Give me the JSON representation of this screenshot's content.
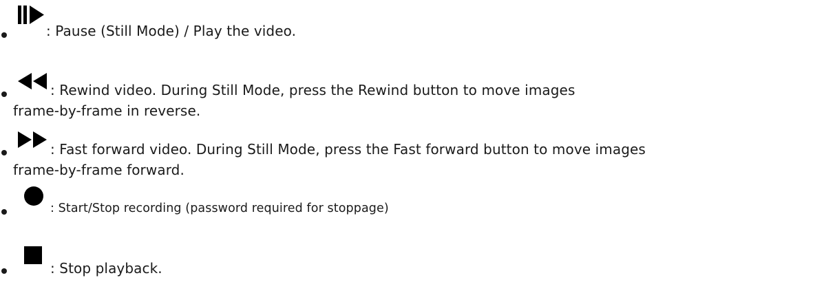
{
  "items": [
    {
      "icon": "pause-play-icon",
      "line1": ": Pause (Still Mode) / Play the video.",
      "line2": ""
    },
    {
      "icon": "rewind-icon",
      "line1": ": Rewind video. During Still Mode, press the Rewind button to move images",
      "line2": "frame-by-frame in reverse."
    },
    {
      "icon": "fast-forward-icon",
      "line1": ": Fast forward video. During Still Mode, press the Fast forward button to move images",
      "line2": "frame-by-frame forward."
    },
    {
      "icon": "record-icon",
      "line1": ": Start/Stop recording (password required for stoppage)",
      "line2": ""
    },
    {
      "icon": "stop-icon",
      "line1": ": Stop playback.",
      "line2": ""
    }
  ],
  "colors": {
    "text": "#1a1a1a",
    "icon": "#000000",
    "background": "#ffffff"
  }
}
